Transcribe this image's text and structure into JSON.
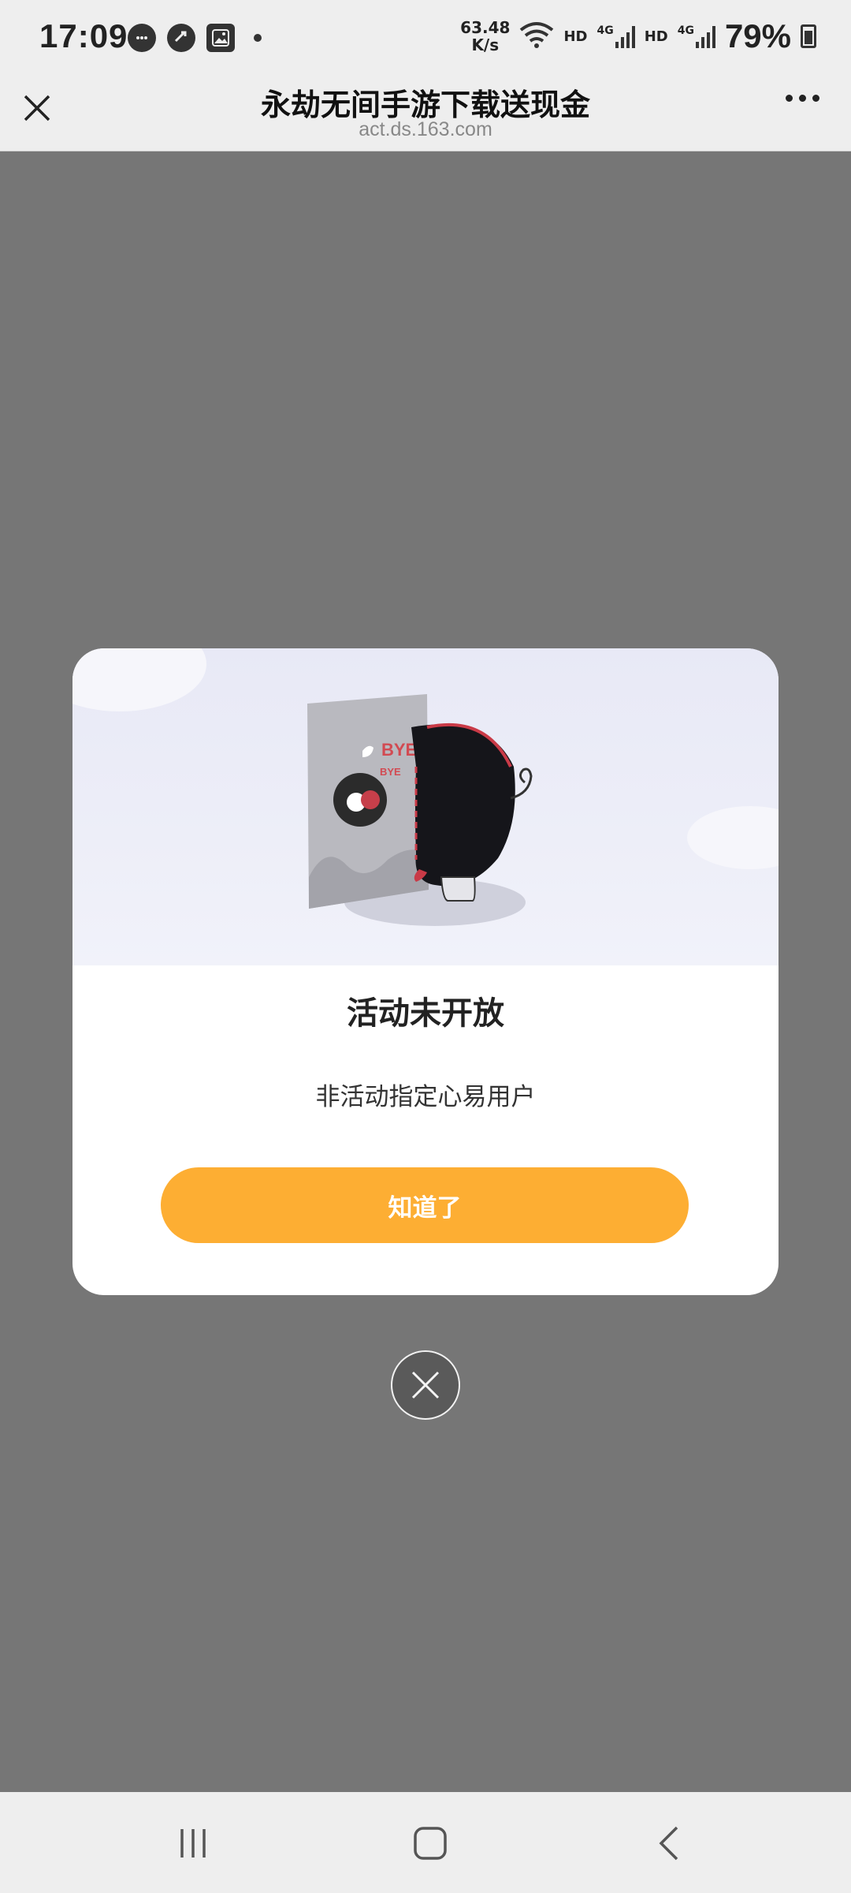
{
  "status_bar": {
    "time": "17:09",
    "net_speed_value": "63.48",
    "net_speed_unit": "K/s",
    "hd1": "HD",
    "lte1": "4G",
    "hd2": "HD",
    "lte2": "4G",
    "battery": "79%",
    "icons": [
      "chat-bubble-icon",
      "sync-icon",
      "gallery-icon",
      "notification-dot-icon",
      "wifi-icon",
      "signal-icon",
      "battery-icon"
    ]
  },
  "title_bar": {
    "title": "永劫无间手游下载送现金",
    "subtitle": "act.ds.163.com"
  },
  "modal": {
    "illustration_text_1": "BYE",
    "illustration_text_2": "BYE",
    "title": "活动未开放",
    "message": "非活动指定心易用户",
    "button_label": "知道了"
  },
  "colors": {
    "overlay": "#767676",
    "accent_button": "#fdae33",
    "bar_bg": "#eeeeee"
  }
}
